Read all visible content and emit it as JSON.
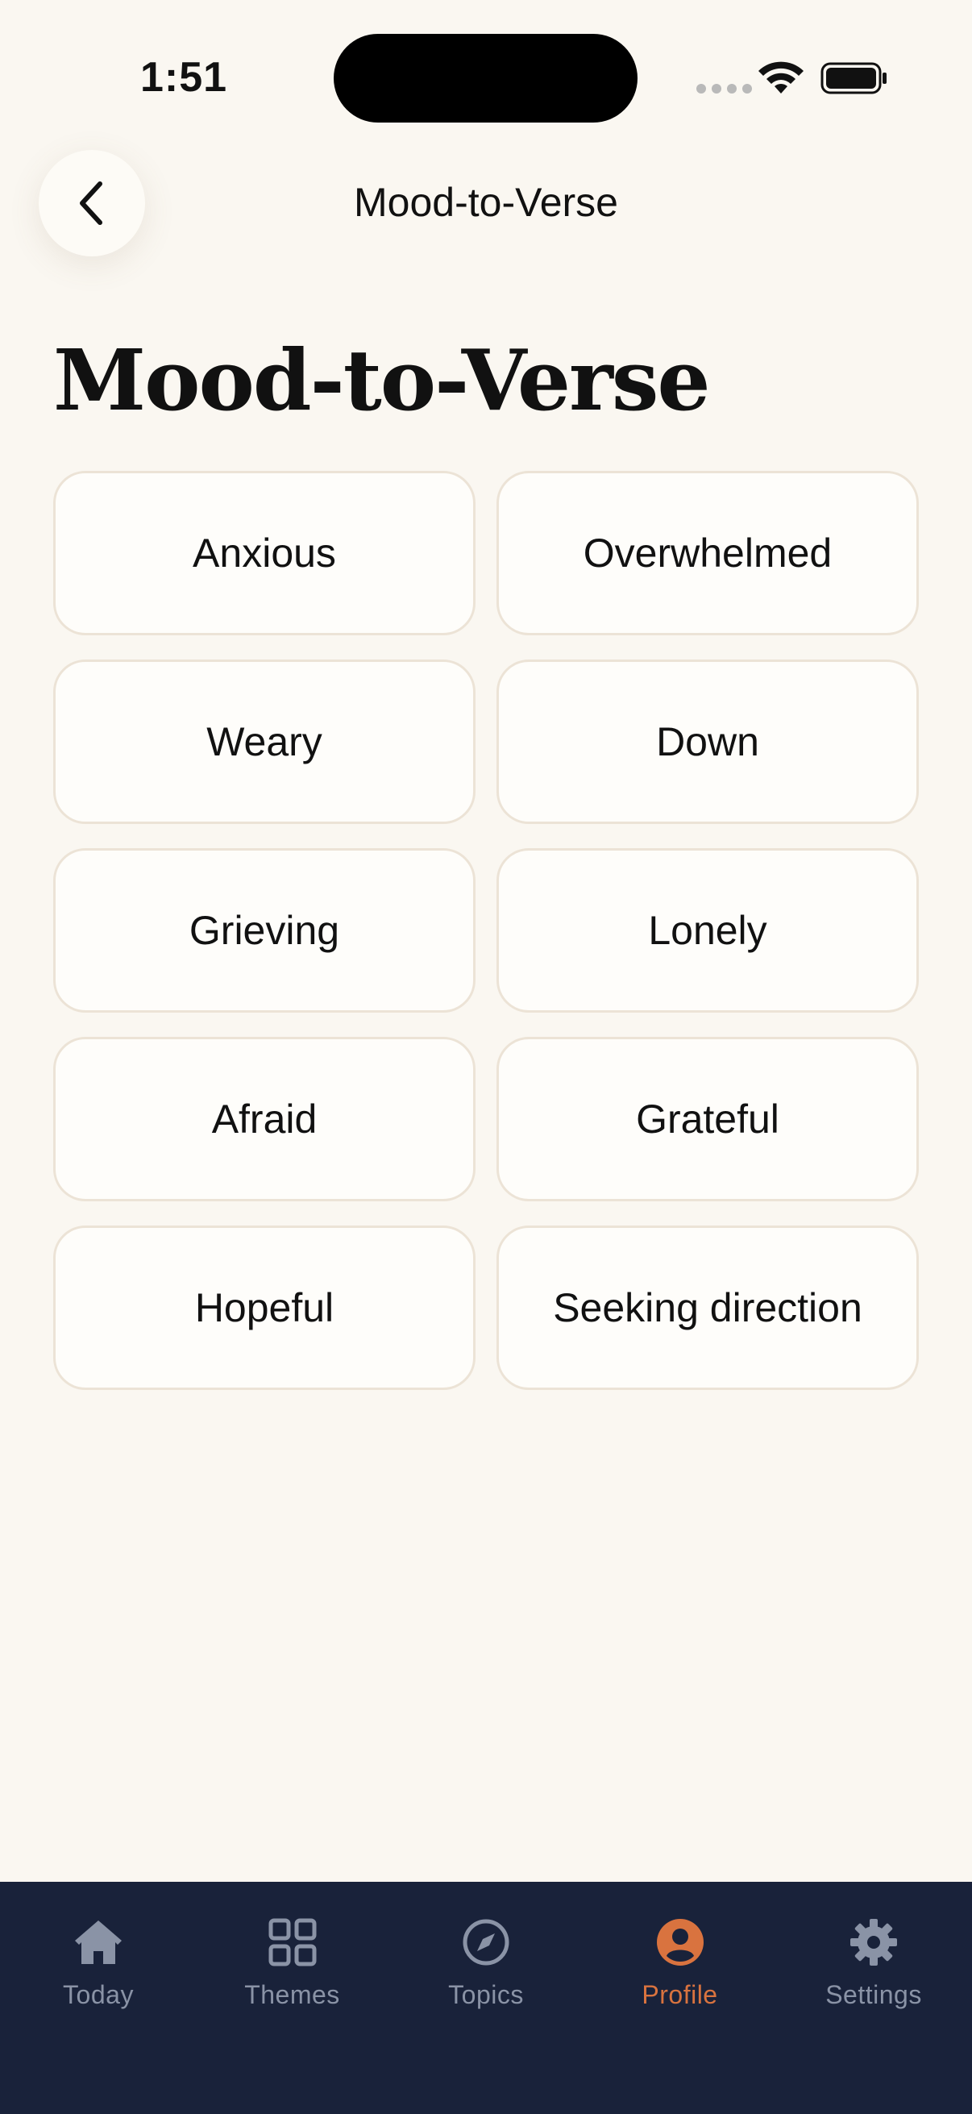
{
  "status_bar": {
    "time": "1:51"
  },
  "nav": {
    "title": "Mood-to-Verse",
    "back_icon": "chevron-left-icon"
  },
  "page": {
    "title": "Mood-to-Verse"
  },
  "moods": [
    {
      "label": "Anxious"
    },
    {
      "label": "Overwhelmed"
    },
    {
      "label": "Weary"
    },
    {
      "label": "Down"
    },
    {
      "label": "Grieving"
    },
    {
      "label": "Lonely"
    },
    {
      "label": "Afraid"
    },
    {
      "label": "Grateful"
    },
    {
      "label": "Hopeful"
    },
    {
      "label": "Seeking direction"
    }
  ],
  "tab_bar": {
    "tabs": [
      {
        "label": "Today",
        "icon": "home-icon",
        "active": false
      },
      {
        "label": "Themes",
        "icon": "grid-icon",
        "active": false
      },
      {
        "label": "Topics",
        "icon": "compass-icon",
        "active": false
      },
      {
        "label": "Profile",
        "icon": "person-icon",
        "active": true
      },
      {
        "label": "Settings",
        "icon": "gear-icon",
        "active": false
      }
    ]
  },
  "colors": {
    "background": "#faf7f1",
    "card_border": "#ece3d6",
    "tab_bar_bg": "#19223a",
    "tab_inactive": "#8a93a6",
    "tab_active": "#d9733f"
  }
}
